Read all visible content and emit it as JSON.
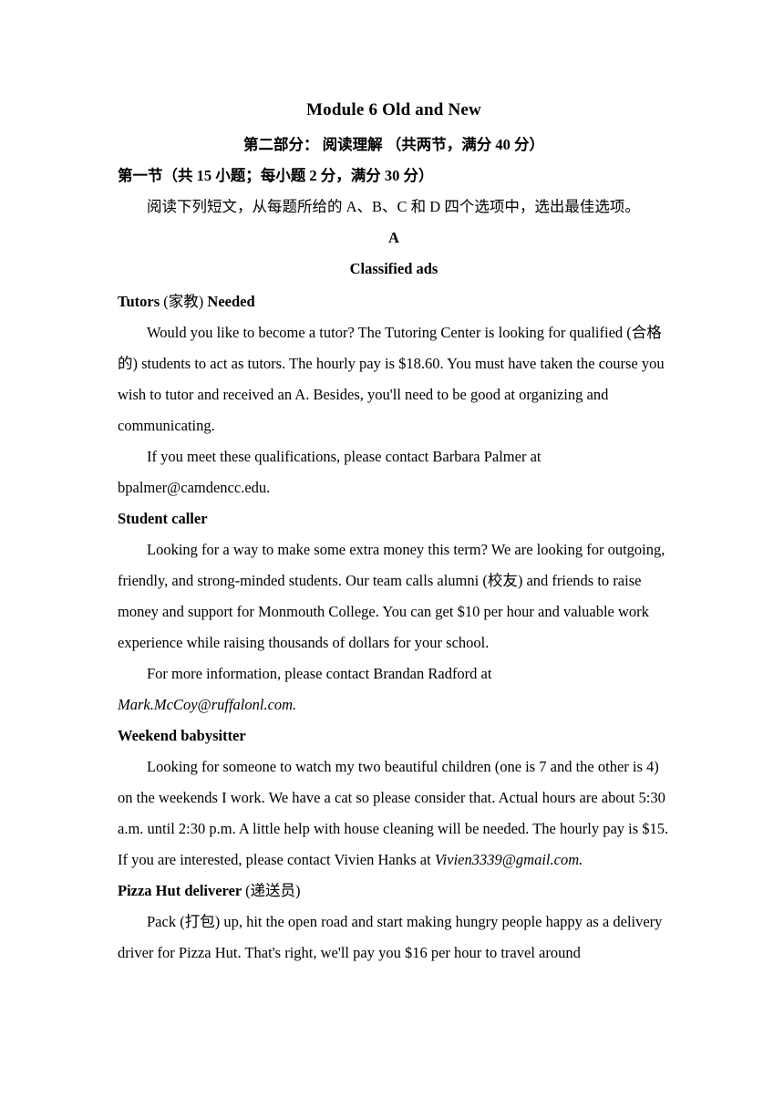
{
  "document": {
    "title": "Module 6 Old and New",
    "part_heading": "第二部分： 阅读理解 （共两节，满分 40 分）",
    "section_heading": "第一节（共 15 小题；每小题 2 分，满分 30 分）",
    "instruction": "阅读下列短文，从每题所给的 A、B、C 和 D 四个选项中，选出最佳选项。",
    "passage_letter": "A",
    "passage_title": "Classified ads"
  },
  "ads": [
    {
      "heading_pre": "Tutors ",
      "heading_cn": "(家教)",
      "heading_post": " Needed",
      "paragraphs": [
        "Would you like to become a tutor? The Tutoring Center is looking for qualified (合格的) students to act as tutors. The hourly pay is $18.60. You must have taken the course you wish to tutor and received an A. Besides, you'll need to be good at organizing and communicating.",
        "If you meet these qualifications, please contact Barbara Palmer at"
      ],
      "contact_plain": "bpalmer@camdencc.edu.",
      "contact_italic": ""
    },
    {
      "heading_pre": "Student caller",
      "heading_cn": "",
      "heading_post": "",
      "paragraphs": [
        "Looking for a way to make some extra money this term? We are looking for outgoing, friendly, and strong-minded students. Our team calls alumni (校友) and friends to raise money and support for Monmouth College. You can get $10 per hour and valuable work experience while raising thousands of dollars for your school.",
        "For more information, please contact Brandan Radford at"
      ],
      "contact_plain": "",
      "contact_italic": "Mark.McCoy@ruffalonl.com."
    },
    {
      "heading_pre": "Weekend babysitter",
      "heading_cn": "",
      "heading_post": "",
      "paragraphs": [
        "Looking for someone to watch my two beautiful children (one is 7 and the other is 4) on the weekends I work. We have a cat so please consider that. Actual hours are about 5:30 a.m. until 2:30 p.m. A little help with house cleaning will be needed. The hourly pay is $15."
      ],
      "contact_prefix": "If you are interested, please contact Vivien Hanks at ",
      "contact_italic": "Vivien3339@gmail.com."
    },
    {
      "heading_pre": "Pizza Hut deliverer ",
      "heading_cn": "(递送员)",
      "heading_post": "",
      "paragraphs": [
        "Pack (打包) up, hit the open road and start making hungry people happy as a delivery driver for Pizza Hut. That's right, we'll pay you $16 per hour to travel around"
      ],
      "contact_plain": "",
      "contact_italic": ""
    }
  ]
}
